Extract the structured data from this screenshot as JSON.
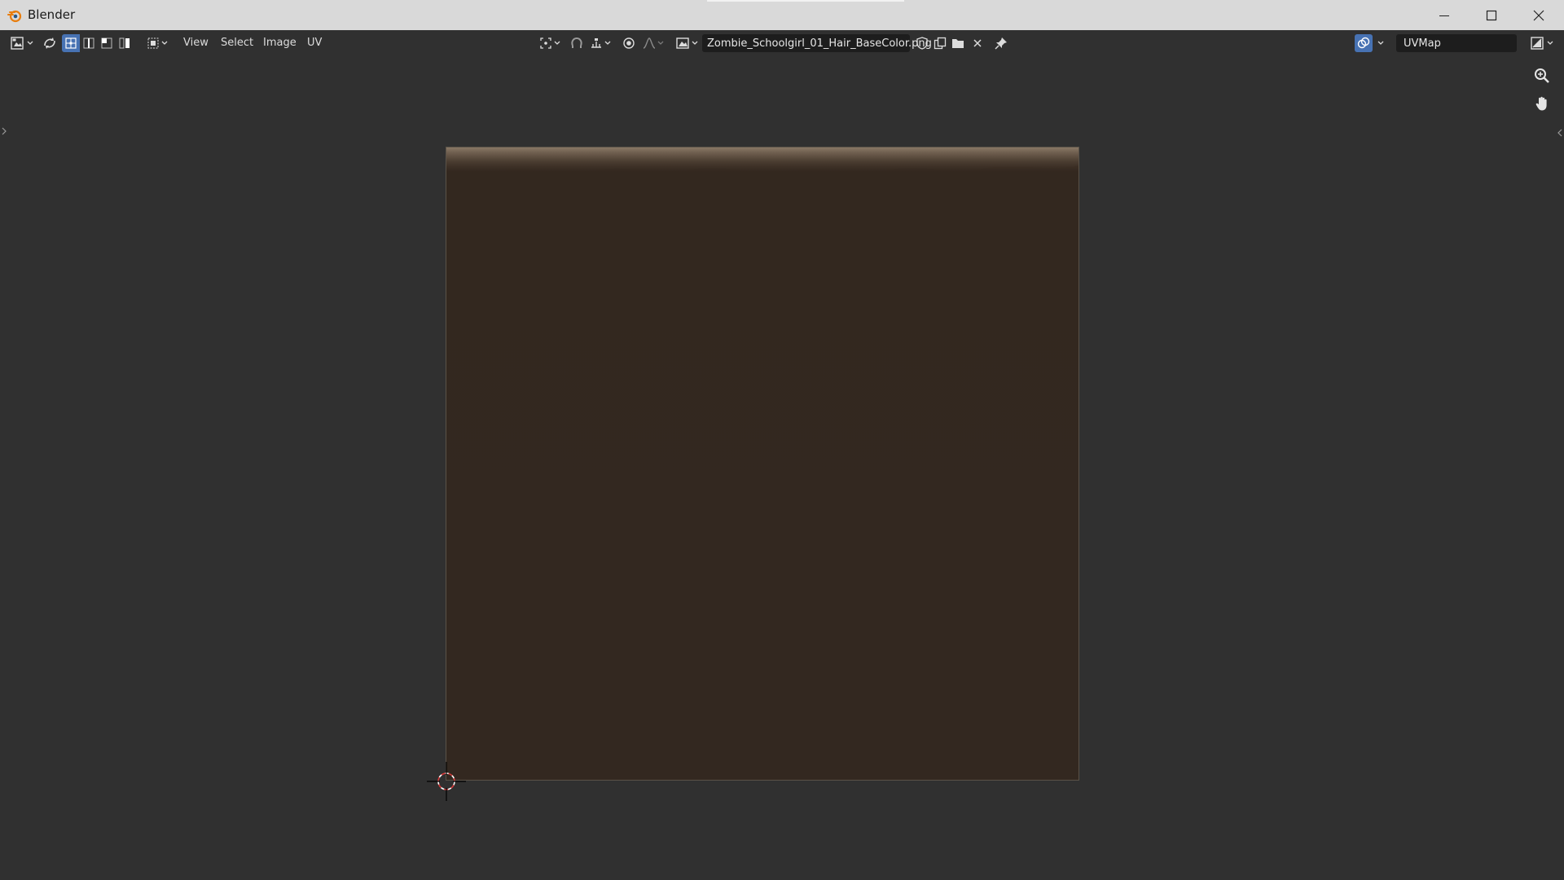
{
  "window": {
    "title": "Blender"
  },
  "header": {
    "menus": [
      "View",
      "Select",
      "Image",
      "UV"
    ],
    "image_name": "Zombie_Schoolgirl_01_Hair_BaseColor.png",
    "uv_map": "UVMap"
  },
  "icons": {
    "editor_type": "image-editor-icon",
    "sync_selection": "uv-sync-select-icon",
    "select_modes": [
      "vertex-select-icon",
      "edge-select-icon",
      "face-select-icon",
      "island-select-icon"
    ],
    "sticky_mode": "sticky-select-icon",
    "pivot": "pivot-point-icon",
    "snap": "snap-icon",
    "snap_increment": "snap-increment-icon",
    "proportional": "proportional-edit-icon",
    "falloff": "falloff-curve-icon",
    "image_browse": "image-browse-icon",
    "fake_user": "fake-user-shield-icon",
    "duplicate": "duplicate-image-icon",
    "open": "open-folder-icon",
    "unlink": "close-icon",
    "pin": "pin-icon",
    "overlays": "overlays-icon",
    "display_channels": "display-channels-icon",
    "zoom": "zoom-icon",
    "pan": "hand-pan-icon"
  },
  "colors": {
    "accent": "#4772b3",
    "background": "#303030",
    "texture_base": "#332820"
  }
}
